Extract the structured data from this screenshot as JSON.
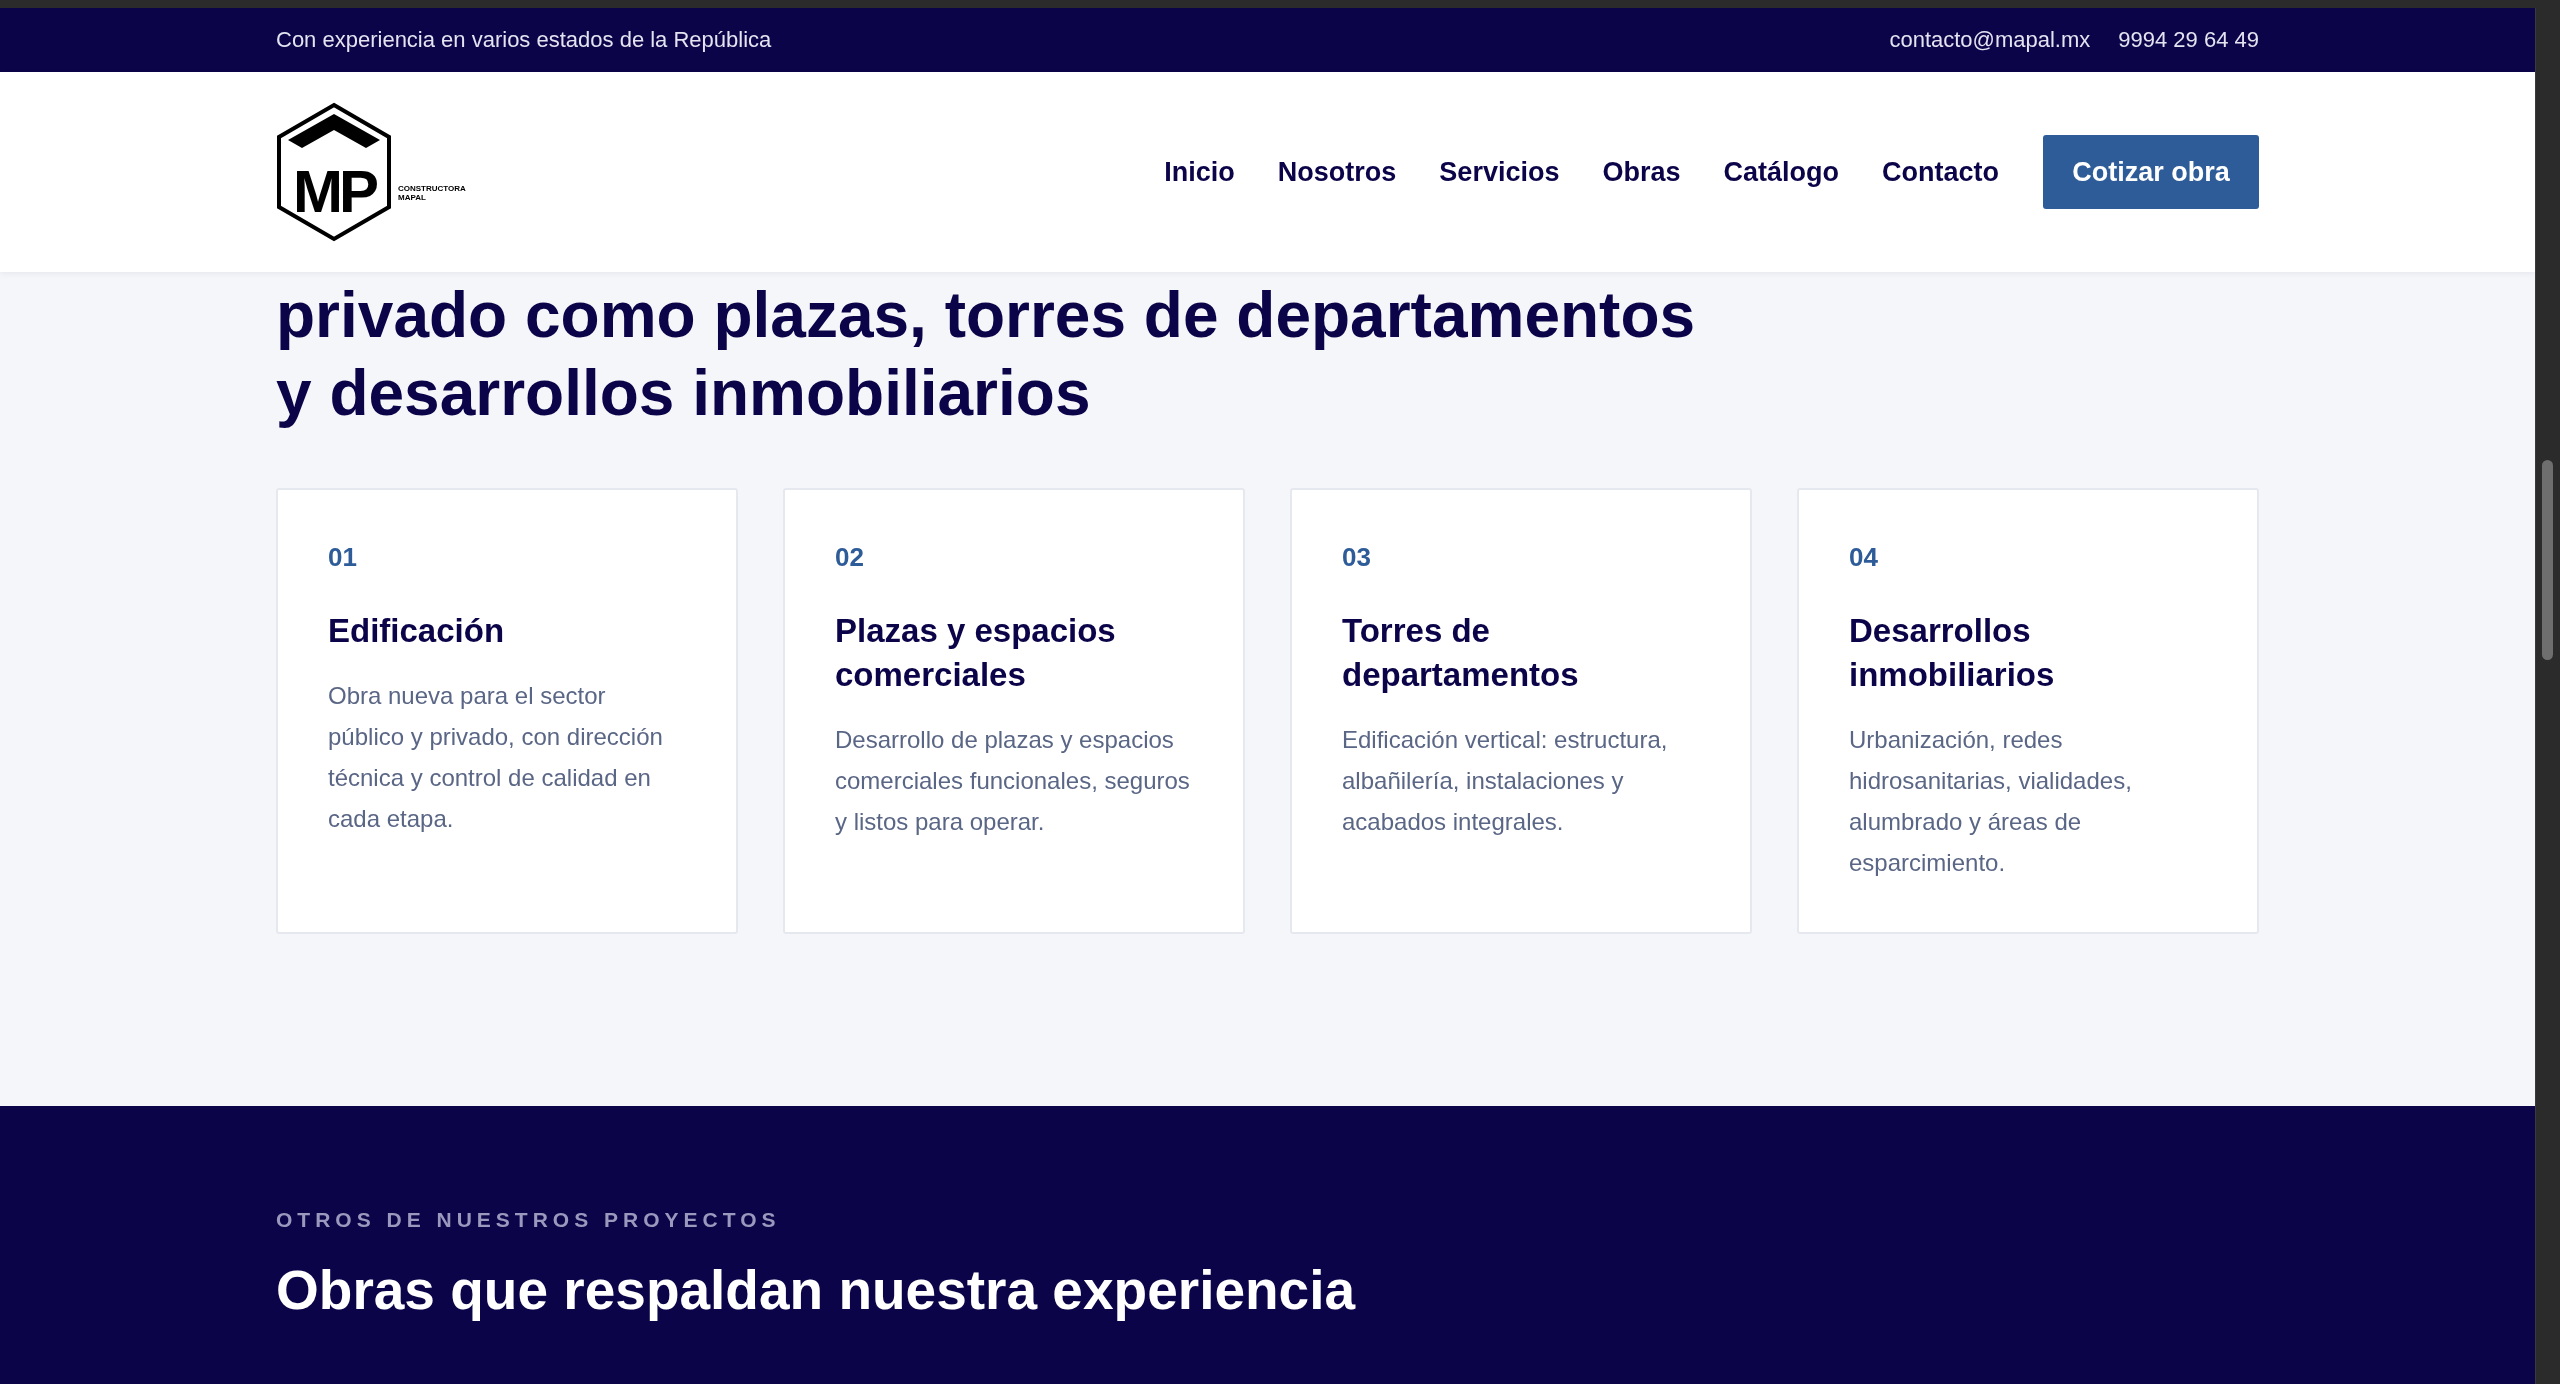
{
  "top_bar": {
    "tagline": "Con experiencia en varios estados de la República",
    "email": "contacto@mapal.mx",
    "phone": "9994 29 64 49"
  },
  "header": {
    "logo": {
      "mark": "MP",
      "name_lines": [
        "CONSTRUCTORA",
        "MAPAL"
      ]
    },
    "nav": [
      {
        "label": "Inicio"
      },
      {
        "label": "Nosotros"
      },
      {
        "label": "Servicios"
      },
      {
        "label": "Obras"
      },
      {
        "label": "Catálogo"
      },
      {
        "label": "Contacto"
      }
    ],
    "cta": "Cotizar obra"
  },
  "intro": {
    "heading_lines": [
      "privado como plazas, torres de departamentos",
      "y desarrollos inmobiliarios"
    ]
  },
  "services": [
    {
      "number": "01",
      "title": "Edificación",
      "description": "Obra nueva para el sector público y privado, con dirección técnica y control de calidad en cada etapa."
    },
    {
      "number": "02",
      "title": "Plazas y espacios comerciales",
      "description": "Desarrollo de plazas y espacios comerciales funcionales, seguros y listos para operar."
    },
    {
      "number": "03",
      "title": "Torres de departamentos",
      "description": "Edificación vertical: estructura, albañilería, instalaciones y acabados integrales."
    },
    {
      "number": "04",
      "title": "Desarrollos inmobiliarios",
      "description": "Urbanización, redes hidrosanitarias, vialidades, alumbrado y áreas de esparcimiento."
    }
  ],
  "projects": {
    "eyebrow": "OTROS DE NUESTROS PROYECTOS",
    "title": "Obras que respaldan nuestra experiencia"
  }
}
